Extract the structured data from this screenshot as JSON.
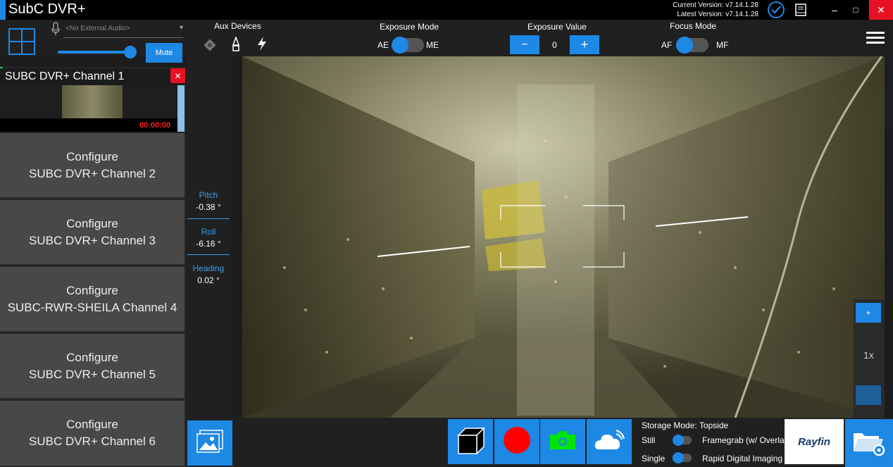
{
  "app": {
    "title": "SubC DVR+",
    "current_version": "Current Version: v7.14.1.28",
    "latest_version": "Latest Version: v7.14.1.28"
  },
  "window": {
    "minimize": "–",
    "maximize": "□",
    "close": "✕"
  },
  "audio": {
    "placeholder": "<No External Audio>",
    "mute_label": "Mute",
    "volume": 0.9
  },
  "aux": {
    "label": "Aux Devices"
  },
  "exposure_mode": {
    "label": "Exposure Mode",
    "left": "AE",
    "right": "ME"
  },
  "exposure_value": {
    "label": "Exposure Value",
    "minus": "−",
    "value": "0",
    "plus": "+"
  },
  "focus_mode": {
    "label": "Focus Mode",
    "left": "AF",
    "right": "MF"
  },
  "channels": {
    "active": {
      "name": "SUBC DVR+ Channel 1",
      "timer": "00:00:00"
    },
    "configure": [
      {
        "line1": "Configure",
        "line2": "SUBC DVR+ Channel 2"
      },
      {
        "line1": "Configure",
        "line2": "SUBC DVR+ Channel 3"
      },
      {
        "line1": "Configure",
        "line2": "SUBC-RWR-SHEILA Channel 4"
      },
      {
        "line1": "Configure",
        "line2": "SUBC DVR+ Channel 5"
      },
      {
        "line1": "Configure",
        "line2": "SUBC DVR+ Channel 6"
      }
    ]
  },
  "telemetry": {
    "pitch": {
      "label": "Pitch",
      "value": "-0.38 °"
    },
    "roll": {
      "label": "Roll",
      "value": "-6.16 °"
    },
    "heading": {
      "label": "Heading",
      "value": "0.02 °"
    }
  },
  "zoom": {
    "plus": "+",
    "level": "1x"
  },
  "storage": {
    "mode": "Storage Mode: Topside",
    "still": "Still",
    "framegrab": "Framegrab (w/ Overlay)",
    "single": "Single",
    "rapid": "Rapid Digital Imaging"
  },
  "brand": {
    "logo": "Rayfin"
  },
  "colors": {
    "accent": "#1e88e5",
    "record": "#ff0000",
    "camera": "#00e600",
    "timer": "#ff2020"
  }
}
